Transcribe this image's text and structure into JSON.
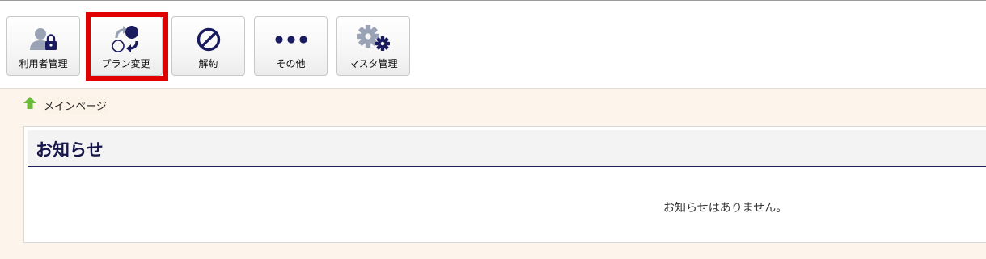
{
  "toolbar": {
    "buttons": [
      {
        "label": "利用者管理",
        "icon": "user-lock-icon"
      },
      {
        "label": "プラン変更",
        "icon": "plan-change-icon"
      },
      {
        "label": "解約",
        "icon": "prohibited-icon"
      },
      {
        "label": "その他",
        "icon": "more-dots-icon"
      },
      {
        "label": "マスタ管理",
        "icon": "gears-icon"
      }
    ],
    "highlighted_button": "プラン変更"
  },
  "breadcrumb": {
    "home_icon": "home-arrow-icon",
    "label": "メインページ"
  },
  "notice": {
    "title": "お知らせ",
    "empty_message": "お知らせはありません。"
  },
  "colors": {
    "highlight_border": "#e00000",
    "icon_navy": "#1a1a5e",
    "icon_gray": "#9aa3b5",
    "home_green": "#6dbb3c",
    "content_background": "#fdf5ec"
  }
}
